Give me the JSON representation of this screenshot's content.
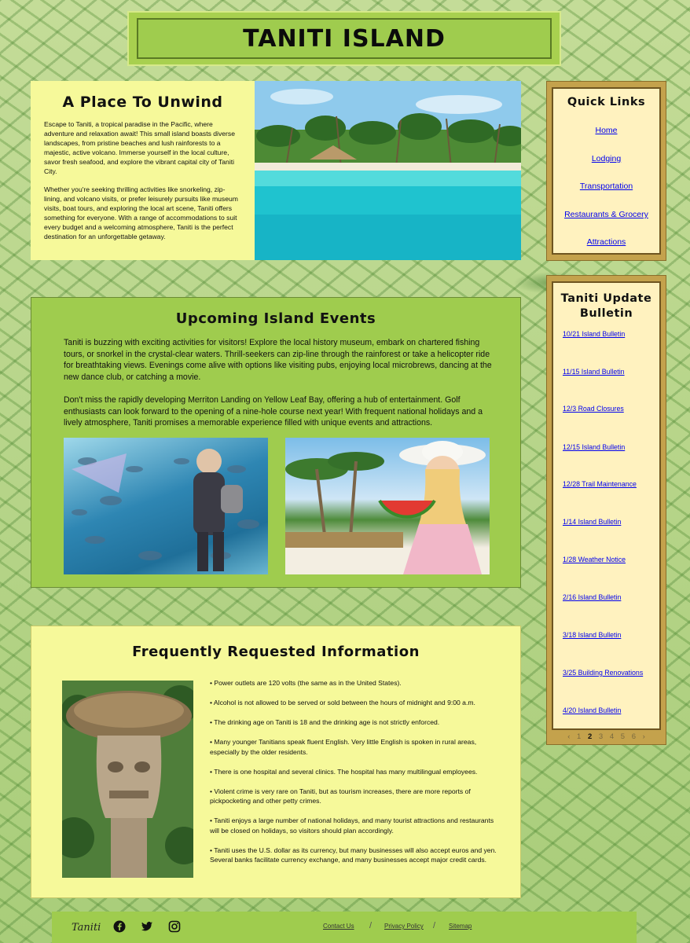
{
  "header": {
    "title": "TANITI ISLAND"
  },
  "intro": {
    "title": "A Place To Unwind",
    "paragraphs": [
      "Escape to Taniti, a tropical paradise in the Pacific, where adventure and relaxation await! This small island boasts diverse landscapes, from pristine beaches and lush rainforests to a majestic, active volcano. Immerse yourself in the local culture, savor fresh seafood, and explore the vibrant capital city of Taniti City.",
      "Whether you're seeking thrilling activities like snorkeling, zip-lining, and volcano visits, or prefer leisurely pursuits like museum visits, boat tours, and exploring the local art scene, Taniti offers something for everyone. With a range of accommodations to suit every budget and a welcoming atmosphere, Taniti is the perfect destination for an unforgettable getaway."
    ]
  },
  "events": {
    "title": "Upcoming Island Events",
    "paragraphs": [
      "Taniti is buzzing with exciting activities for visitors! Explore the local history museum, embark on chartered fishing tours, or snorkel in the crystal-clear waters. Thrill-seekers can zip-line through the rainforest or take a helicopter ride for breathtaking views. Evenings come alive with options like visiting pubs, enjoying local microbrews, dancing at the new dance club, or catching a movie.",
      "Don't miss the rapidly developing Merriton Landing on Yellow Leaf Bay, offering a hub of entertainment. Golf enthusiasts can look forward to the opening of a nine-hole course next year! With frequent national holidays and a lively atmosphere, Taniti promises a memorable experience filled with unique events and attractions."
    ]
  },
  "faq": {
    "title": "Frequently Requested Information",
    "items": [
      "• Power outlets are 120 volts (the same as in the United States).",
      "• Alcohol is not allowed to be served or sold between the hours of midnight and 9:00 a.m.",
      "• The drinking age on Taniti is 18 and the drinking age is not strictly enforced.",
      "• Many younger Tanitians speak fluent English. Very little English is spoken in rural areas, especially by the older residents.",
      "• There is one hospital and several clinics. The hospital has many multilingual employees.",
      "• Violent crime is very rare on Taniti, but as tourism increases, there are more reports of pickpocketing and other petty crimes.",
      "• Taniti enjoys a large number of national holidays, and many tourist attractions and restaurants will be closed on holidays, so visitors should plan accordingly.",
      "• Taniti uses the U.S. dollar as its currency, but many businesses will also accept euros and yen. Several banks facilitate currency exchange, and many businesses accept major credit cards."
    ]
  },
  "quick_links": {
    "title": "Quick Links",
    "links": [
      "Home",
      "Lodging",
      "Transportation",
      "Restaurants & Grocery",
      "Attractions"
    ]
  },
  "bulletin": {
    "title": "Taniti Update Bulletin",
    "links": [
      "10/21 Island Bulletin",
      "11/15 Island Bulletin",
      "12/3 Road Closures",
      "12/15 Island Bulletin",
      "12/28 Trail Maintenance",
      "1/14 Island Bulletin",
      "1/28 Weather Notice",
      "2/16 Island Bulletin",
      "3/18 Island Bulletin",
      "3/25 Building Renovations",
      "4/20 Island Bulletin"
    ],
    "pager": {
      "prev": "‹",
      "pages": [
        "1",
        "2",
        "3",
        "4",
        "5",
        "6"
      ],
      "current": "2",
      "next": "›"
    }
  },
  "footer": {
    "logo": "Taniti",
    "links": [
      "Contact Us",
      "Privacy Policy",
      "Sitemap"
    ],
    "separator": "/",
    "social_icons": [
      "facebook-icon",
      "twitter-icon",
      "instagram-icon"
    ]
  },
  "colors": {
    "accent_green": "#9fcc4e",
    "panel_yellow": "#f6f99a",
    "sidebar_gold": "#c4a24c",
    "sidebar_cream": "#fff2bf",
    "link_blue": "#0000ee"
  }
}
